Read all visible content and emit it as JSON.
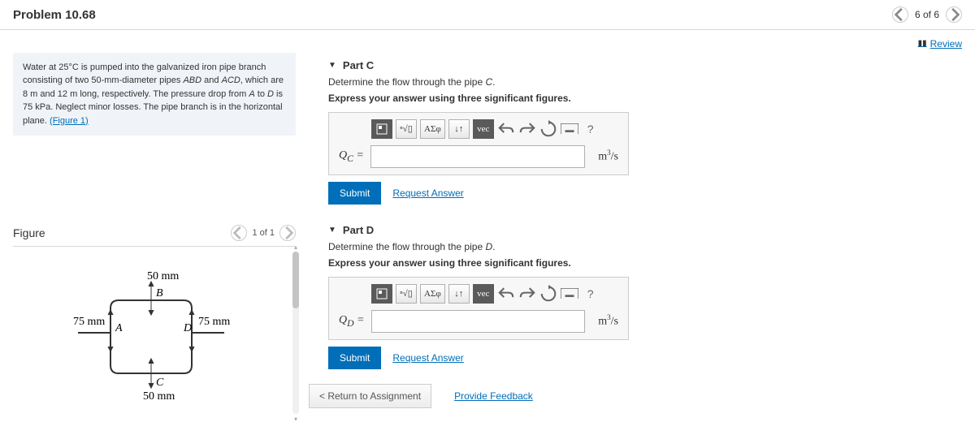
{
  "header": {
    "title": "Problem 10.68",
    "pager": {
      "label": "6 of 6"
    }
  },
  "review_label": "Review",
  "problem": {
    "html_pre": "Water at 25°C is pumped into the galvanized iron pipe branch consisting of two 50-mm-diameter pipes ",
    "seg1_i": "ABD",
    "seg2": " and ",
    "seg2_i": "ACD",
    "seg3": ", which are 8 m and 12 m long, respectively. The pressure drop from ",
    "seg3_i": "A",
    "seg4": " to ",
    "seg4_i": "D",
    "seg5": " is 75 kPa. Neglect minor losses. The pipe branch is in the horizontal plane. ",
    "figure_link": "(Figure 1)"
  },
  "figure": {
    "title": "Figure",
    "pager": "1 of 1",
    "labels": {
      "topDim": "50 mm",
      "leftDim": "75 mm",
      "rightDim": "75 mm",
      "botDim": "50 mm",
      "A": "A",
      "B": "B",
      "C": "C",
      "D": "D"
    }
  },
  "partC": {
    "title": "Part C",
    "prompt": "Determine the flow through the pipe C.",
    "instr": "Express your answer using three significant figures.",
    "var": "Q_C",
    "unit": "m³/s"
  },
  "partD": {
    "title": "Part D",
    "prompt": "Determine the flow through the pipe D.",
    "instr": "Express your answer using three significant figures.",
    "var": "Q_D",
    "unit": "m³/s"
  },
  "toolbar": {
    "template": "template",
    "root": "root",
    "greek": "ΑΣφ",
    "updown": "↓↑",
    "vec": "vec",
    "undo": "undo",
    "redo": "redo",
    "reset": "reset",
    "keyboard": "keyboard",
    "help": "?"
  },
  "actions": {
    "submit": "Submit",
    "request": "Request Answer",
    "return": "< Return to Assignment",
    "feedback": "Provide Feedback"
  }
}
